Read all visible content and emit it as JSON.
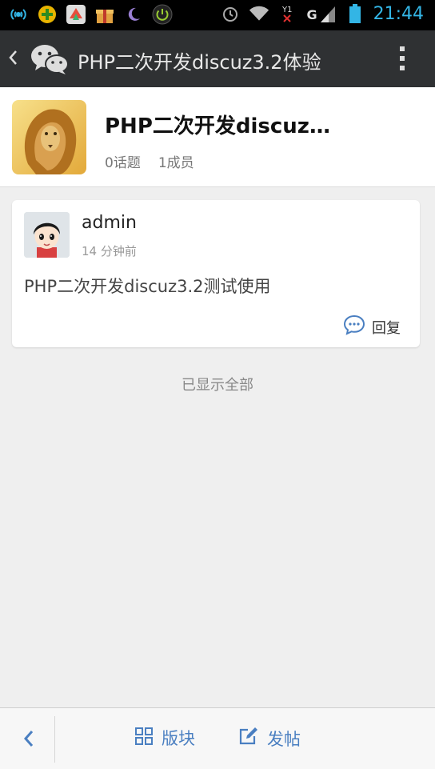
{
  "status_bar": {
    "time": "21:44",
    "network_label": "G",
    "icons": [
      "signal-broadcast-icon",
      "plus-badge-icon",
      "app-cube-icon",
      "gift-box-icon",
      "moon-icon",
      "power-icon",
      "alarm-icon",
      "wifi-icon",
      "sim-icon",
      "cell-signal-icon",
      "battery-icon"
    ]
  },
  "action_bar": {
    "title": "PHP二次开发discuz3.2体验"
  },
  "group": {
    "name": "PHP二次开发discuz3.2…",
    "topics": "0话题",
    "members": "1成员"
  },
  "post": {
    "username": "admin",
    "time": "14 分钟前",
    "content": "PHP二次开发discuz3.2测试使用",
    "reply_label": "回复"
  },
  "footer_note": "已显示全部",
  "bottom_bar": {
    "boards_label": "版块",
    "post_label": "发帖"
  },
  "colors": {
    "accent": "#4a7fc1",
    "statusbar_text": "#33b5e5",
    "actionbar_bg": "#2f3133"
  }
}
